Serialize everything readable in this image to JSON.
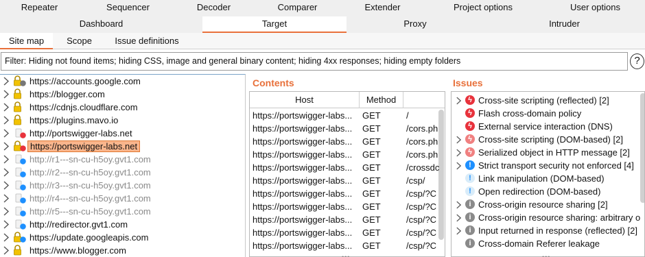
{
  "tabs_row1": [
    "Repeater",
    "Sequencer",
    "Decoder",
    "Comparer",
    "Extender",
    "Project options",
    "User options"
  ],
  "tabs_row2": [
    "Dashboard",
    "Target",
    "Proxy",
    "Intruder"
  ],
  "active_main_tab": "Target",
  "subtabs": [
    "Site map",
    "Scope",
    "Issue definitions"
  ],
  "active_subtab": "Site map",
  "filter_text": "Filter: Hiding not found items;  hiding CSS, image and general binary content;  hiding 4xx responses;  hiding empty folders",
  "help_label": "?",
  "tree": [
    {
      "host": "https://accounts.google.com",
      "chevron": true,
      "lock": true,
      "dot": "grey",
      "grey": false
    },
    {
      "host": "https://blogger.com",
      "chevron": true,
      "lock": true,
      "dot": "",
      "grey": false
    },
    {
      "host": "https://cdnjs.cloudflare.com",
      "chevron": true,
      "lock": true,
      "dot": "",
      "grey": false
    },
    {
      "host": "https://plugins.mavo.io",
      "chevron": true,
      "lock": true,
      "dot": "",
      "grey": false
    },
    {
      "host": "http://portswigger-labs.net",
      "chevron": true,
      "lock": false,
      "dot": "red",
      "grey": false
    },
    {
      "host": "https://portswigger-labs.net",
      "chevron": true,
      "lock": true,
      "dot": "red",
      "grey": false,
      "selected": true
    },
    {
      "host": "http://r1---sn-cu-h5oy.gvt1.com",
      "chevron": true,
      "lock": false,
      "dot": "blue",
      "grey": true
    },
    {
      "host": "http://r2---sn-cu-h5oy.gvt1.com",
      "chevron": true,
      "lock": false,
      "dot": "blue",
      "grey": true
    },
    {
      "host": "http://r3---sn-cu-h5oy.gvt1.com",
      "chevron": true,
      "lock": false,
      "dot": "blue",
      "grey": true
    },
    {
      "host": "http://r4---sn-cu-h5oy.gvt1.com",
      "chevron": true,
      "lock": false,
      "dot": "blue",
      "grey": true
    },
    {
      "host": "http://r5---sn-cu-h5oy.gvt1.com",
      "chevron": true,
      "lock": false,
      "dot": "blue",
      "grey": true
    },
    {
      "host": "http://redirector.gvt1.com",
      "chevron": true,
      "lock": false,
      "dot": "blue",
      "grey": false
    },
    {
      "host": "https://update.googleapis.com",
      "chevron": true,
      "lock": true,
      "dot": "blue",
      "grey": false
    },
    {
      "host": "https://www.blogger.com",
      "chevron": true,
      "lock": true,
      "dot": "",
      "grey": false
    }
  ],
  "contents_title": "Contents",
  "contents_headers": [
    "Host",
    "Method",
    ""
  ],
  "contents_rows": [
    [
      "https://portswigger-labs...",
      "GET",
      "/"
    ],
    [
      "https://portswigger-labs...",
      "GET",
      "/cors.ph"
    ],
    [
      "https://portswigger-labs...",
      "GET",
      "/cors.ph"
    ],
    [
      "https://portswigger-labs...",
      "GET",
      "/cors.ph"
    ],
    [
      "https://portswigger-labs...",
      "GET",
      "/crossdc"
    ],
    [
      "https://portswigger-labs...",
      "GET",
      "/csp/"
    ],
    [
      "https://portswigger-labs...",
      "GET",
      "/csp/?C"
    ],
    [
      "https://portswigger-labs...",
      "GET",
      "/csp/?C"
    ],
    [
      "https://portswigger-labs...",
      "GET",
      "/csp/?C"
    ],
    [
      "https://portswigger-labs...",
      "GET",
      "/csp/?C"
    ],
    [
      "https://portswigger-labs...",
      "GET",
      "/csp/?C"
    ]
  ],
  "issues_title": "Issues",
  "issues": [
    {
      "text": "Cross-site scripting (reflected) [2]",
      "chevron": true,
      "severity": "high"
    },
    {
      "text": "Flash cross-domain policy",
      "chevron": false,
      "severity": "high"
    },
    {
      "text": "External service interaction (DNS)",
      "chevron": false,
      "severity": "high"
    },
    {
      "text": "Cross-site scripting (DOM-based) [2]",
      "chevron": true,
      "severity": "high-tentative"
    },
    {
      "text": "Serialized object in HTTP message [2]",
      "chevron": true,
      "severity": "high-tentative"
    },
    {
      "text": "Strict transport security not enforced [4]",
      "chevron": true,
      "severity": "low"
    },
    {
      "text": "Link manipulation (DOM-based)",
      "chevron": false,
      "severity": "low-tentative"
    },
    {
      "text": "Open redirection (DOM-based)",
      "chevron": false,
      "severity": "low-tentative"
    },
    {
      "text": "Cross-origin resource sharing [2]",
      "chevron": true,
      "severity": "info"
    },
    {
      "text": "Cross-origin resource sharing: arbitrary o",
      "chevron": true,
      "severity": "info"
    },
    {
      "text": "Input returned in response (reflected) [2]",
      "chevron": true,
      "severity": "info"
    },
    {
      "text": "Cross-domain Referer leakage",
      "chevron": false,
      "severity": "info"
    }
  ],
  "colors": {
    "accent": "#e8703a",
    "high": "#e8323c",
    "high_tentative": "#f08080",
    "low": "#1e90ff",
    "low_tentative": "#8ec8f0",
    "info": "#8a8a8a"
  }
}
